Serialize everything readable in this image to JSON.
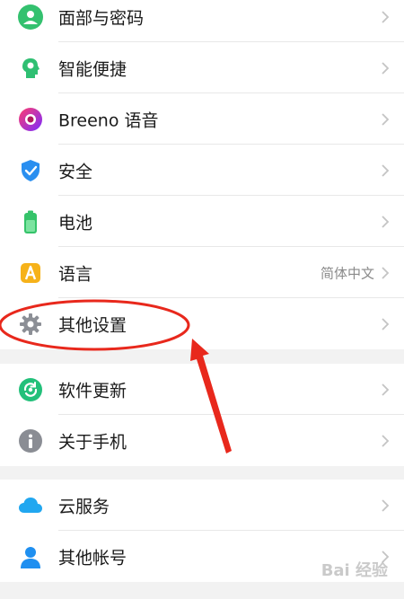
{
  "group1": {
    "items": [
      {
        "label": "面部与密码",
        "icon": "face-password-icon"
      },
      {
        "label": "智能便捷",
        "icon": "smart-convenience-icon"
      },
      {
        "label": "Breeno 语音",
        "icon": "breeno-voice-icon"
      },
      {
        "label": "安全",
        "icon": "security-shield-icon"
      },
      {
        "label": "电池",
        "icon": "battery-icon"
      },
      {
        "label": "语言",
        "value": "简体中文",
        "icon": "language-icon"
      },
      {
        "label": "其他设置",
        "icon": "gear-icon"
      }
    ]
  },
  "group2": {
    "items": [
      {
        "label": "软件更新",
        "icon": "software-update-icon"
      },
      {
        "label": "关于手机",
        "icon": "info-icon"
      }
    ]
  },
  "group3": {
    "items": [
      {
        "label": "云服务",
        "icon": "cloud-icon"
      },
      {
        "label": "其他帐号",
        "icon": "person-icon"
      }
    ]
  },
  "annotation": {
    "color": "#e8281c"
  },
  "watermark": {
    "text": "Bai 经验"
  }
}
